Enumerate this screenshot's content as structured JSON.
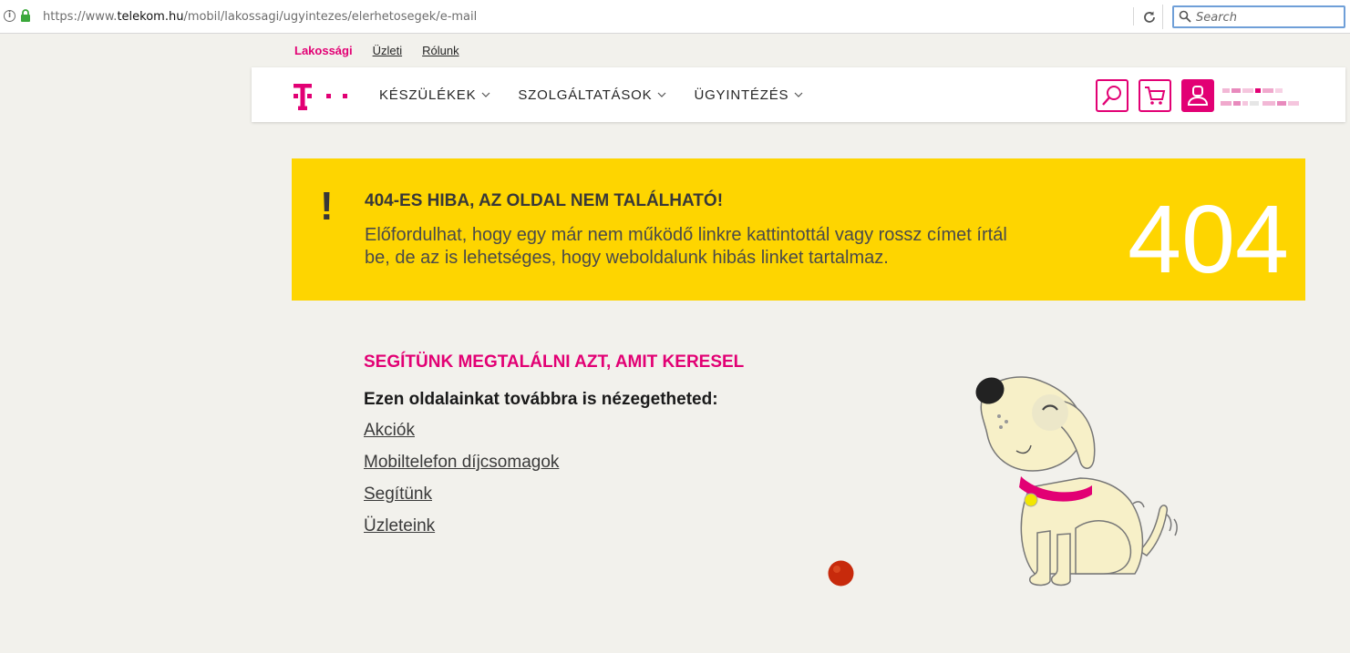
{
  "browser": {
    "url_prefix": "https://www.",
    "url_domain": "telekom.hu",
    "url_path": "/mobil/lakossagi/ugyintezes/elerhetosegek/e-mail",
    "search_placeholder": "Search"
  },
  "toplinks": [
    {
      "label": "Lakossági"
    },
    {
      "label": "Üzleti"
    },
    {
      "label": "Rólunk"
    }
  ],
  "nav": [
    {
      "label": "KÉSZÜLÉKEK"
    },
    {
      "label": "SZOLGÁLTATÁSOK"
    },
    {
      "label": "ÜGYINTÉZÉS"
    }
  ],
  "colors": {
    "brand": "#e20074",
    "banner": "#fed500",
    "background": "#f2f1ec"
  },
  "icons": [
    "info-icon",
    "lock-icon",
    "reload-icon",
    "search-icon",
    "magnifier-icon",
    "cart-icon",
    "user-icon",
    "chevron-down-icon"
  ],
  "error": {
    "mark": "!",
    "title": "404-ES HIBA, AZ OLDAL NEM TALÁLHATÓ!",
    "text": "Előfordulhat, hogy egy már nem működő linkre kattintottál vagy rossz címet írtál be, de az is lehetséges, hogy weboldalunk hibás linket tartalmaz.",
    "code": "404"
  },
  "help": {
    "title": "SEGÍTÜNK MEGTALÁLNI AZT, AMIT KERESEL",
    "subtitle": "Ezen oldalainkat továbbra is nézegetheted:",
    "links": [
      {
        "label": "Akciók"
      },
      {
        "label": "Mobiltelefon díjcsomagok"
      },
      {
        "label": "Segítünk"
      },
      {
        "label": "Üzleteink"
      }
    ]
  }
}
